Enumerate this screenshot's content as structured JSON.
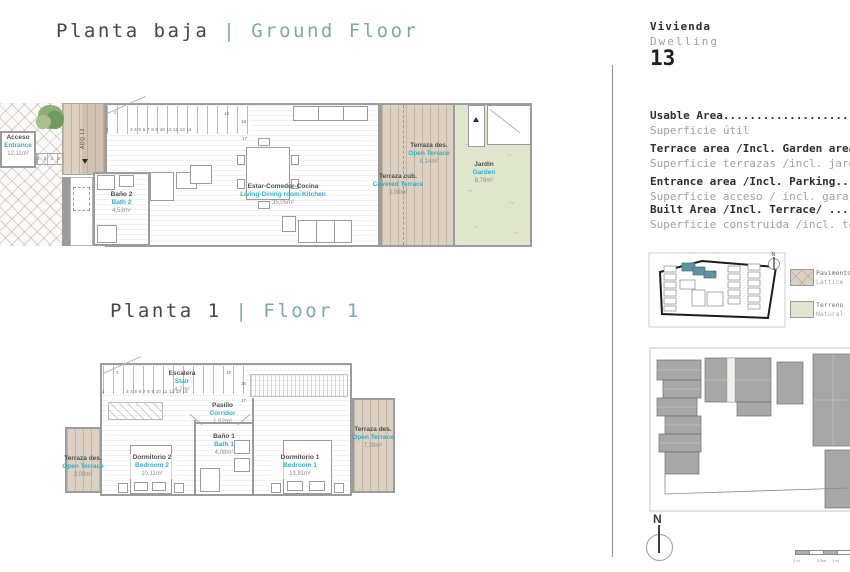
{
  "titles": {
    "ground_es": "Planta baja",
    "ground_sep": "|",
    "ground_en": "Ground Floor",
    "floor1_es": "Planta 1",
    "floor1_sep": "|",
    "floor1_en": "Floor 1"
  },
  "dwelling": {
    "label_es": "Vivienda",
    "label_en": "Dwelling",
    "number": "13"
  },
  "area_table": {
    "rows": [
      {
        "en": "Usable Area...........................",
        "es": "Superficie útil"
      },
      {
        "en": "Terrace area /Incl. Garden area.......",
        "es": "Superficie terrazas /incl. jardín....."
      },
      {
        "en": "Entrance area /Incl. Parking..........",
        "es": "Superficie acceso / incl. garaje......"
      },
      {
        "en": "Built Area /Incl. Terrace/ ...........",
        "es": "Superficie construida /incl. terraza.."
      }
    ]
  },
  "ground": {
    "rooms": {
      "acceso": {
        "es": "Acceso",
        "en": "Entrance",
        "area": "12,11m²"
      },
      "bano2": {
        "es": "Baño 2",
        "en": "Bath 2",
        "area": "4,53m²"
      },
      "living": {
        "es": "Estar-Comedor-Cocina",
        "en": "Living-Dining room-Kitchen",
        "area": "35,05m²"
      },
      "terraza_cub": {
        "es": "Terraza cub.",
        "en": "Covered Terrace",
        "area": "3,08m²"
      },
      "terraza_des": {
        "es": "Terraza des.",
        "en": "Open Terrace",
        "area": "8,14m²"
      },
      "jardin": {
        "es": "Jardín",
        "en": "Garden",
        "area": "8,79m²"
      }
    },
    "door_tag": "ADQ 13",
    "entry_steps": "1 2 3 4"
  },
  "floor1": {
    "rooms": {
      "escalera": {
        "es": "Escalera",
        "en": "Stair",
        "area": "4,7m²"
      },
      "pasillo": {
        "es": "Pasillo",
        "en": "Corridor",
        "area": "1,92m²"
      },
      "bano1": {
        "es": "Baño 1",
        "en": "Bath 1",
        "area": "4,08m²"
      },
      "dorm2": {
        "es": "Dormitorio 2",
        "en": "Bedroom 2",
        "area": "10,11m²"
      },
      "dorm1": {
        "es": "Dormitorio 1",
        "en": "Bedroom 1",
        "area": "13,91m²"
      },
      "terraza_izq": {
        "es": "Terraza des.",
        "en": "Open Terrace",
        "area": "3,08m²"
      },
      "terraza_der": {
        "es": "Terraza des.",
        "en": "Open Terrace",
        "area": "7,39m²"
      }
    }
  },
  "stairs": {
    "n1": "1",
    "n2": "2",
    "run": "3 4 5 6 7 8 9 10 11 12 13 14",
    "n15": "15",
    "n16": "16",
    "n17": "17"
  },
  "legend": {
    "items": [
      {
        "es": "Pavimento",
        "en": "Lattice"
      },
      {
        "es": "Terreno",
        "en": "Natural"
      }
    ]
  },
  "compass": {
    "label": "N"
  },
  "scalebar": {
    "labels": [
      "0 m",
      "0,5m",
      "1 m"
    ]
  },
  "icons": {
    "garden_arrow": "→"
  },
  "colors": {
    "accent_teal": "#2fb0c8",
    "title_teal": "#7fa7ae",
    "terrace_tan": "#dbd0c2",
    "garden_green": "#e0e6cd",
    "keyplan_highlight": "#5e93a0",
    "site_gray": "#a7a7a7"
  }
}
